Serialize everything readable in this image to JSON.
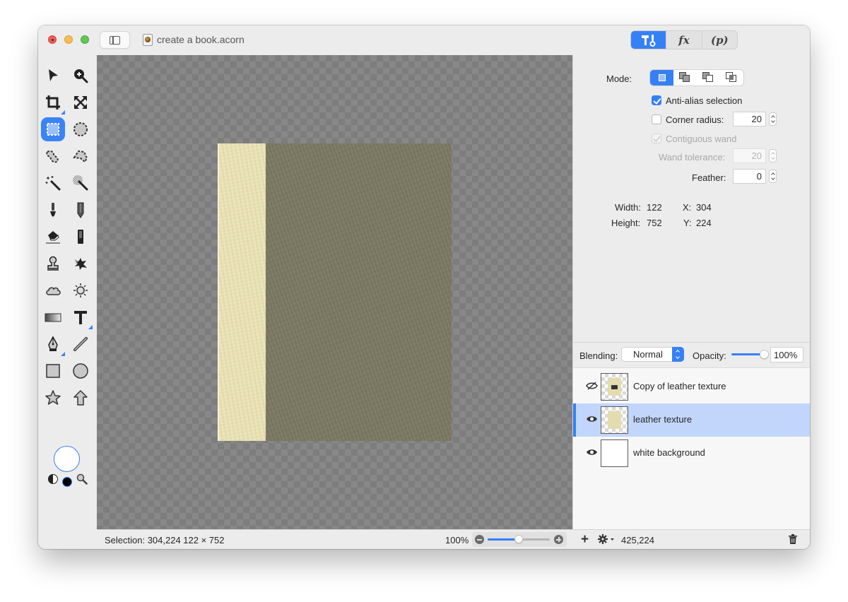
{
  "window": {
    "title": "create a book.acorn",
    "doc_icon": "acorn-document-icon",
    "sidebar_toggle_icon": "sidebar-icon"
  },
  "inspector_tabs": [
    {
      "name": "tools",
      "label": "",
      "icon": "hammer-wrench-icon",
      "active": true
    },
    {
      "name": "effects",
      "label": "fx",
      "active": false
    },
    {
      "name": "properties",
      "label": "(p)",
      "active": false
    }
  ],
  "tools": [
    {
      "name": "move",
      "icon": "arrow-cursor-icon"
    },
    {
      "name": "zoom",
      "icon": "zoom-in-icon"
    },
    {
      "name": "crop",
      "icon": "crop-icon",
      "has_submenu": true
    },
    {
      "name": "transform",
      "icon": "expand-arrows-icon"
    },
    {
      "name": "rect-select",
      "icon": "rect-select-icon",
      "active": true
    },
    {
      "name": "ellipse-select",
      "icon": "ellipse-select-icon"
    },
    {
      "name": "lasso",
      "icon": "lasso-icon"
    },
    {
      "name": "polygon-lasso",
      "icon": "polygon-lasso-icon"
    },
    {
      "name": "magic-wand",
      "icon": "magic-wand-icon"
    },
    {
      "name": "color-wand",
      "icon": "color-wand-icon"
    },
    {
      "name": "brush",
      "icon": "brush-icon"
    },
    {
      "name": "pencil",
      "icon": "pencil-icon"
    },
    {
      "name": "eraser",
      "icon": "eraser-icon"
    },
    {
      "name": "paint-bucket",
      "icon": "paint-bucket-icon"
    },
    {
      "name": "clone",
      "icon": "clone-stamp-icon"
    },
    {
      "name": "smudge",
      "icon": "splatter-icon"
    },
    {
      "name": "blur",
      "icon": "cloud-icon"
    },
    {
      "name": "dodge",
      "icon": "sun-icon"
    },
    {
      "name": "gradient",
      "icon": "gradient-icon"
    },
    {
      "name": "text",
      "icon": "text-icon",
      "has_submenu": true
    },
    {
      "name": "pen",
      "icon": "pen-nib-icon",
      "has_submenu": true
    },
    {
      "name": "line",
      "icon": "line-icon"
    },
    {
      "name": "rectangle",
      "icon": "rectangle-shape-icon"
    },
    {
      "name": "oval",
      "icon": "oval-shape-icon"
    },
    {
      "name": "star",
      "icon": "star-shape-icon"
    },
    {
      "name": "arrow",
      "icon": "arrow-shape-icon"
    }
  ],
  "colors": {
    "foreground": "#ffffff",
    "background": "#000000",
    "accent": "#3680f6",
    "selected_row": "#c2d6fb"
  },
  "tool_options": {
    "mode_label": "Mode:",
    "modes": [
      "replace",
      "add",
      "subtract",
      "intersect"
    ],
    "active_mode": "replace",
    "anti_alias": {
      "label": "Anti-alias selection",
      "checked": true
    },
    "corner_radius": {
      "label": "Corner radius:",
      "checked": false,
      "value": "20"
    },
    "contiguous_wand": {
      "label": "Contiguous wand",
      "checked": true,
      "disabled": true
    },
    "wand_tolerance": {
      "label": "Wand tolerance:",
      "value": "20",
      "disabled": true
    },
    "feather": {
      "label": "Feather:",
      "value": "0"
    },
    "width_label": "Width:",
    "width_value": "122",
    "height_label": "Height:",
    "height_value": "752",
    "x_label": "X:",
    "x_value": "304",
    "y_label": "Y:",
    "y_value": "224"
  },
  "layers_panel": {
    "blending_label": "Blending:",
    "blending_value": "Normal",
    "opacity_label": "Opacity:",
    "opacity_value": "100%",
    "opacity_fraction": 1.0,
    "layers": [
      {
        "name": "Copy of leather texture",
        "visible": false,
        "selected": false,
        "thumb": "book-cover"
      },
      {
        "name": "leather texture",
        "visible": true,
        "selected": true,
        "thumb": "leather"
      },
      {
        "name": "white background",
        "visible": true,
        "selected": false,
        "thumb": "white"
      }
    ]
  },
  "status_bar": {
    "selection_text": "Selection: 304,224 122 × 752",
    "zoom_label": "100%",
    "zoom_fraction": 0.5,
    "cursor_coords": "425,224",
    "add_label": "+"
  }
}
